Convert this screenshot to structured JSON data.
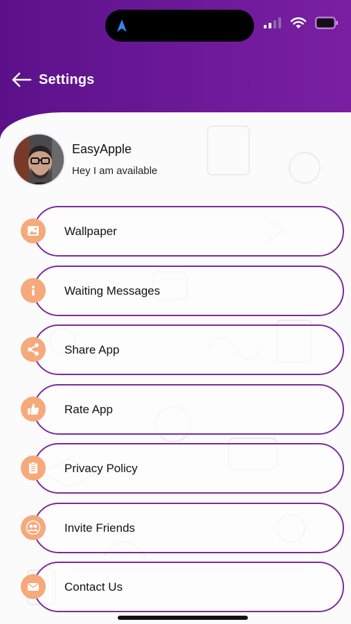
{
  "colors": {
    "header_purple": "#6e1a9a",
    "pill_border": "#7b2a9c",
    "icon_orange": "#f6a97b"
  },
  "header": {
    "title": "Settings",
    "back_icon": "arrow-left-icon"
  },
  "profile": {
    "name": "EasyApple",
    "status": "Hey I am available"
  },
  "menu": {
    "items": [
      {
        "label": "Wallpaper",
        "icon": "image-icon"
      },
      {
        "label": "Waiting Messages",
        "icon": "info-icon"
      },
      {
        "label": "Share App",
        "icon": "share-icon"
      },
      {
        "label": "Rate App",
        "icon": "thumbs-up-icon"
      },
      {
        "label": "Privacy Policy",
        "icon": "clipboard-icon"
      },
      {
        "label": "Invite Friends",
        "icon": "users-icon"
      },
      {
        "label": "Contact Us",
        "icon": "mail-icon"
      }
    ]
  }
}
